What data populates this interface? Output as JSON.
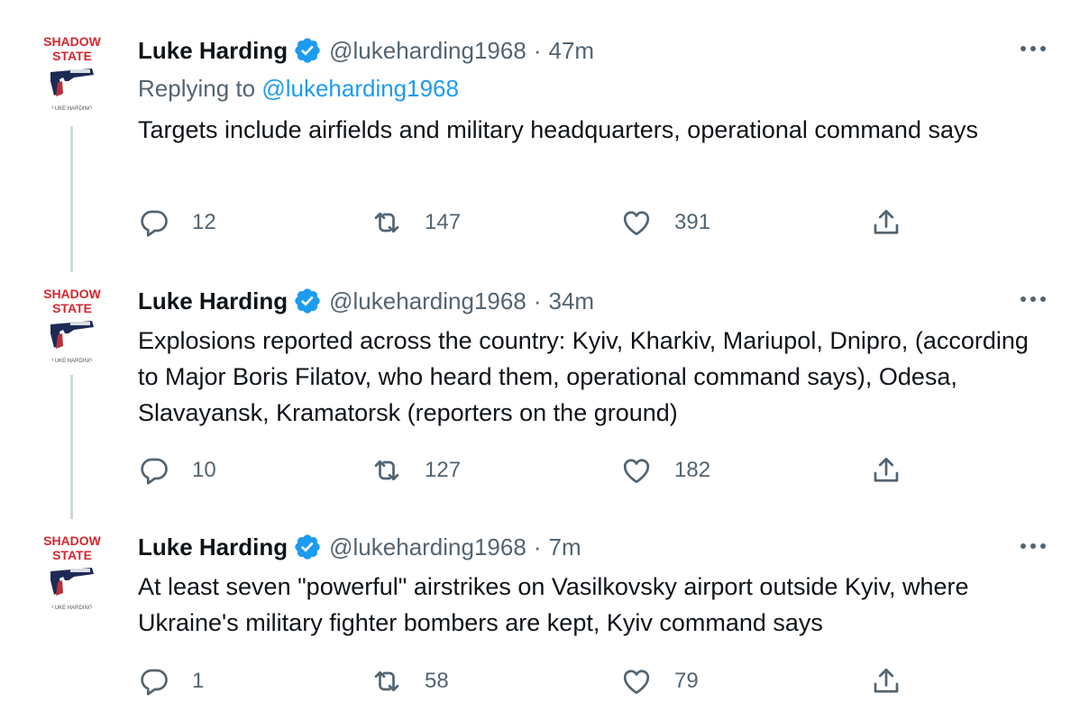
{
  "tweets": [
    {
      "name": "Luke Harding",
      "handle": "@lukeharding1968",
      "separator": "·",
      "time": "47m",
      "replying_prefix": "Replying to",
      "replying_to": "@lukeharding1968",
      "text": "Targets include airfields and military headquarters, operational command says",
      "replies": "12",
      "retweets": "147",
      "likes": "391"
    },
    {
      "name": "Luke Harding",
      "handle": "@lukeharding1968",
      "separator": "·",
      "time": "34m",
      "text": "Explosions reported across the country: Kyiv, Kharkiv, Mariupol, Dnipro, (according to Major Boris Filatov, who heard them, operational command says), Odesa, Slavayansk, Kramatorsk (reporters on the ground)",
      "replies": "10",
      "retweets": "127",
      "likes": "182"
    },
    {
      "name": "Luke Harding",
      "handle": "@lukeharding1968",
      "separator": "·",
      "time": "7m",
      "text": "At least seven \"powerful\" airstrikes on Vasilkovsky airport outside Kyiv, where Ukraine's military fighter bombers are kept, Kyiv command says",
      "replies": "1",
      "retweets": "58",
      "likes": "79"
    }
  ],
  "avatar": {
    "line1": "SHADOW",
    "line2": "STATE",
    "author": "LUKE HARDING",
    "title_color": "#d7262e"
  },
  "colors": {
    "text": "#0f1419",
    "secondary": "#536471",
    "link": "#1d9bf0",
    "verified": "#1d9bf0",
    "thread_line": "#cfd9de"
  },
  "icons": [
    "verified-badge-icon",
    "more-options-icon",
    "reply-icon",
    "retweet-icon",
    "like-icon",
    "share-icon"
  ]
}
